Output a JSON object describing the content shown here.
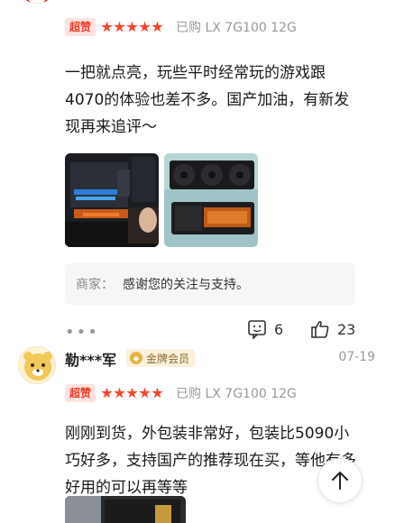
{
  "review1": {
    "tag": "超赞",
    "rating": 5,
    "purchased": "已购 LX 7G100 12G",
    "content": "一把就点亮，玩些平时经常玩的游戏跟4070的体验也差不多。国产加油，有新发现再来追评～",
    "photos": [
      "pc-build-photo",
      "graphics-cards-photo"
    ],
    "reply": {
      "who": "商家：",
      "text": "感谢您的关注与支持。"
    },
    "comment_count": "6",
    "like_count": "23"
  },
  "review2": {
    "username": "勒***军",
    "member_badge": "金牌会员",
    "date": "07-19",
    "tag": "超赞",
    "rating": 5,
    "purchased": "已购 LX 7G100 12G",
    "content": "刚刚到货，外包装非常好，包装比5090小巧好多，支持国产的推荐现在买，等他有多好用的可以再等等"
  },
  "colors": {
    "accent_red": "#f5472b",
    "tag_bg": "#fde3df",
    "gold": "#e8b445"
  },
  "icons": [
    "more-dots-icon",
    "comment-icon",
    "thumbs-up-icon",
    "arrow-up-icon",
    "star-icon",
    "gold-member-icon"
  ]
}
